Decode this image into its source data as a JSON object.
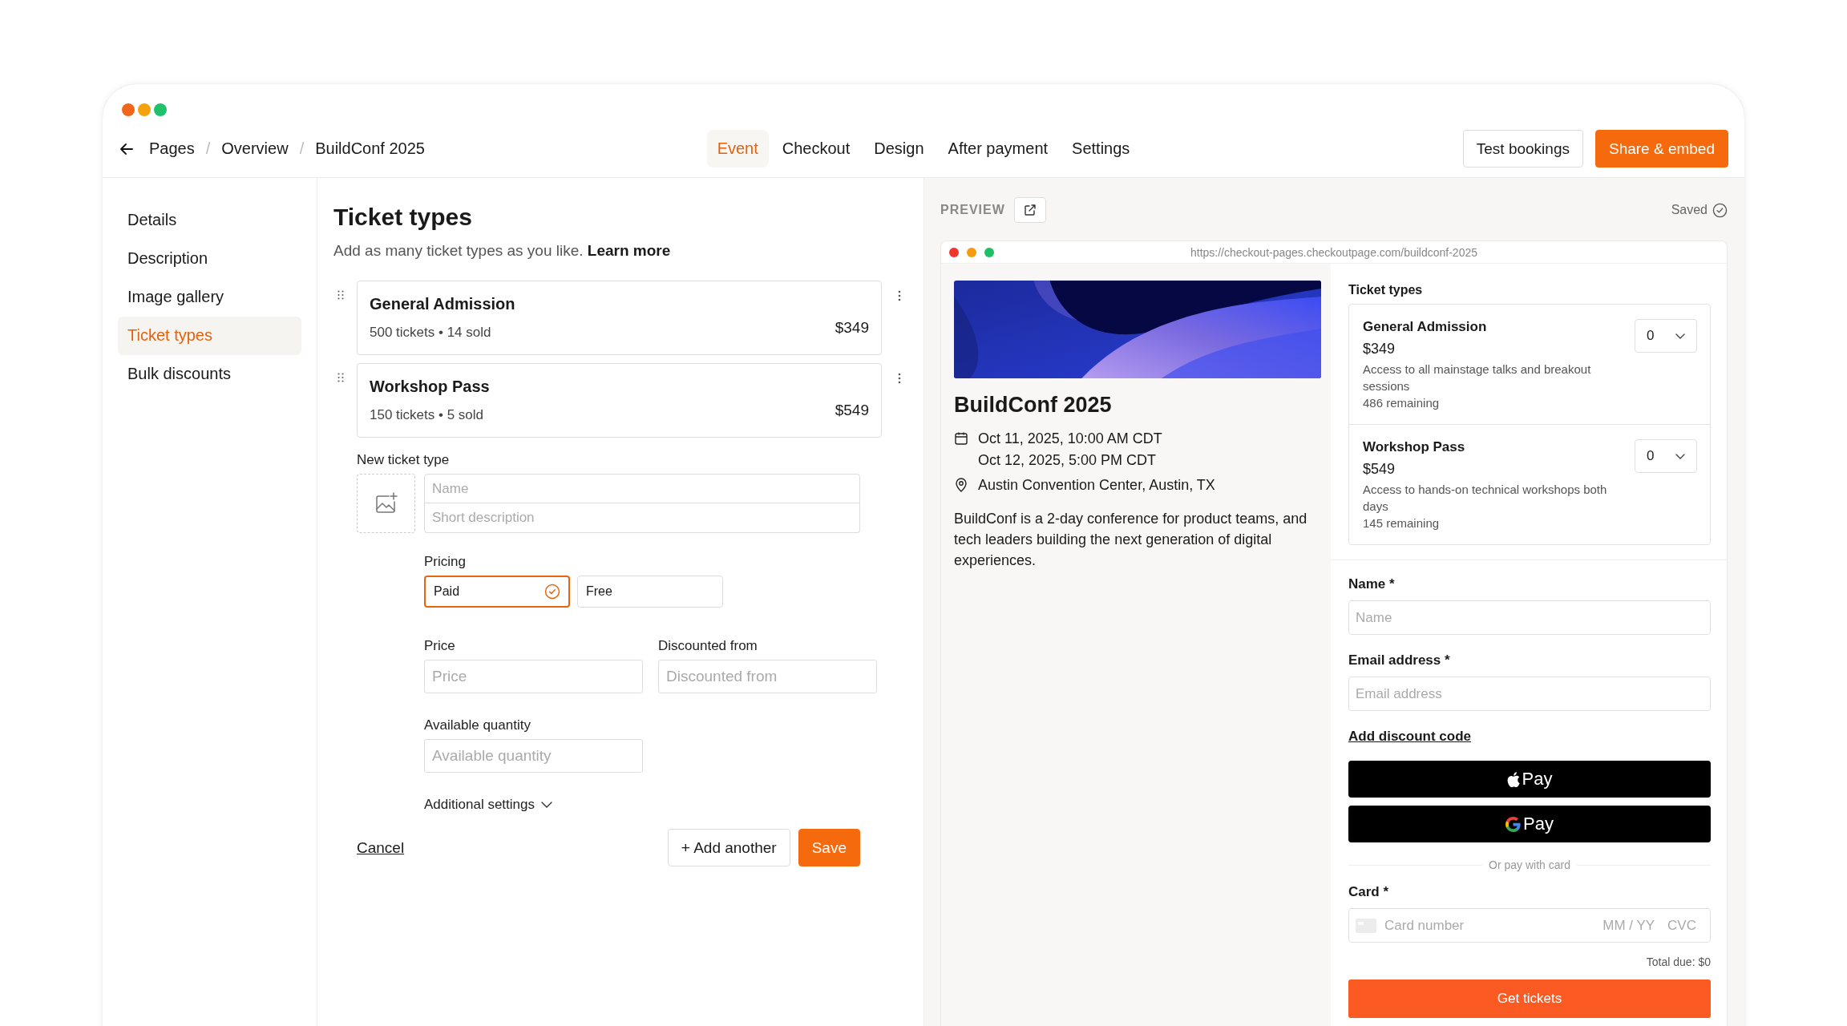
{
  "window": {
    "controls": [
      {
        "color": "#f2661c"
      },
      {
        "color": "#f5a20f"
      },
      {
        "color": "#1fc16b"
      }
    ]
  },
  "breadcrumb": {
    "items": [
      "Pages",
      "Overview",
      "BuildConf 2025"
    ],
    "separator": "/"
  },
  "tabs": [
    {
      "label": "Event",
      "selected": true
    },
    {
      "label": "Checkout",
      "selected": false
    },
    {
      "label": "Design",
      "selected": false
    },
    {
      "label": "After payment",
      "selected": false
    },
    {
      "label": "Settings",
      "selected": false
    }
  ],
  "header_actions": [
    {
      "label": "Test bookings",
      "kind": "secondary"
    },
    {
      "label": "Share & embed",
      "kind": "primary"
    }
  ],
  "sidebar": {
    "items": [
      {
        "label": "Details",
        "selected": false
      },
      {
        "label": "Description",
        "selected": false
      },
      {
        "label": "Image gallery",
        "selected": false
      },
      {
        "label": "Ticket types",
        "selected": true
      },
      {
        "label": "Bulk discounts",
        "selected": false
      }
    ]
  },
  "editor": {
    "title": "Ticket types",
    "description": "Add as many ticket types as you like.",
    "link": "Learn more",
    "ticket_types": [
      {
        "name": "General Admission",
        "summary": "500 tickets • 14 sold",
        "price": "$349"
      },
      {
        "name": "Workshop Pass",
        "summary": "150 tickets • 5 sold",
        "price": "$549"
      }
    ],
    "new_ticket": {
      "label": "New ticket type",
      "name_placeholder": "Name",
      "description_placeholder": "Short description",
      "pricing_label": "Pricing",
      "pricing_options": [
        {
          "label": "Paid",
          "selected": true
        },
        {
          "label": "Free",
          "selected": false
        }
      ],
      "fields": [
        {
          "label": "Price",
          "placeholder": "Price"
        },
        {
          "label": "Discounted from",
          "placeholder": "Discounted from"
        },
        {
          "label": "Available quantity",
          "placeholder": "Available quantity"
        }
      ],
      "additional_settings": "Additional settings"
    },
    "actions": {
      "cancel": "Cancel",
      "add_another": "+ Add another",
      "save": "Save"
    }
  },
  "preview": {
    "label": "PREVIEW",
    "status": "Saved",
    "url": "https://checkout-pages.checkoutpage.com/buildconf-2025",
    "browser_controls": [
      {
        "color": "#f0352c"
      },
      {
        "color": "#f79a0f"
      },
      {
        "color": "#1fbf68"
      }
    ],
    "event": {
      "image": {
        "kind": "picture"
      },
      "title": "BuildConf 2025",
      "dates": [
        "Oct 11, 2025, 10:00 AM CDT",
        "Oct 12, 2025, 5:00 PM CDT"
      ],
      "location": "Austin Convention Center, Austin, TX",
      "description": "BuildConf is a 2-day conference for product teams, and tech leaders building the next generation of digital experiences."
    },
    "checkout": {
      "heading": "Ticket types",
      "tickets": [
        {
          "name": "General Admission",
          "price": "$349",
          "description": "Access to all mainstage talks and breakout sessions",
          "remaining": "486 remaining",
          "quantity": "0"
        },
        {
          "name": "Workshop Pass",
          "price": "$549",
          "description": "Access to hands-on technical workshops both days",
          "remaining": "145 remaining",
          "quantity": "0"
        }
      ],
      "fields": [
        {
          "label": "Name *",
          "placeholder": "Name"
        },
        {
          "label": "Email address *",
          "placeholder": "Email address"
        }
      ],
      "discount_link": "Add discount code",
      "wallets": [
        {
          "kind": "apple",
          "label": "Pay"
        },
        {
          "kind": "google",
          "label": "Pay"
        }
      ],
      "divider": "Or pay with card",
      "card": {
        "label": "Card *",
        "placeholder": "Card number",
        "expiry": "MM / YY",
        "cvc": "CVC"
      },
      "total": "Total due: $0",
      "submit": "Get tickets"
    }
  }
}
